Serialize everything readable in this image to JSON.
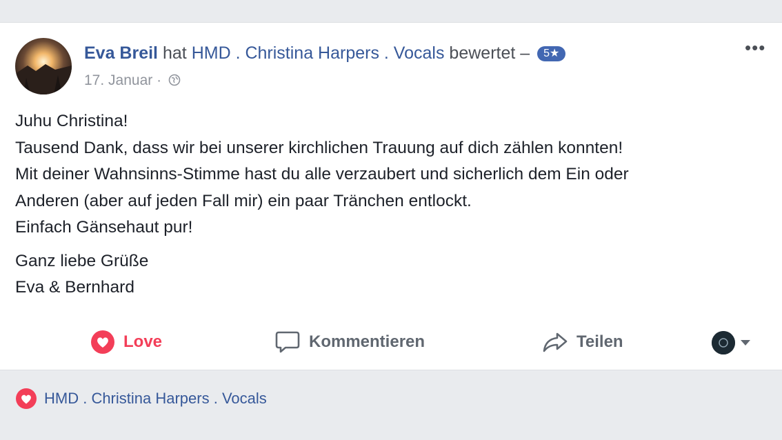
{
  "post": {
    "author": "Eva Breil",
    "verb": "hat",
    "page": "HMD . Christina Harpers . Vocals",
    "action": "bewertet –",
    "rating": "5★",
    "date": "17. Januar",
    "separator": "·",
    "privacy_icon": "globe-icon",
    "body": {
      "paragraph1": [
        "Juhu Christina!",
        "Tausend Dank, dass wir bei unserer kirchlichen Trauung auf dich zählen konnten!",
        "Mit deiner Wahnsinns-Stimme hast du alle verzaubert und sicherlich dem Ein oder",
        "Anderen (aber auf jeden Fall mir) ein paar Tränchen entlockt.",
        "Einfach Gänsehaut pur!"
      ],
      "paragraph2": [
        "Ganz liebe Grüße",
        "Eva & Bernhard"
      ]
    }
  },
  "actions": {
    "love": "Love",
    "comment": "Kommentieren",
    "share": "Teilen"
  },
  "footer": {
    "reactor": "HMD . Christina Harpers . Vocals"
  },
  "colors": {
    "link": "#365899",
    "love": "#f33e58",
    "badge": "#4267b2"
  }
}
